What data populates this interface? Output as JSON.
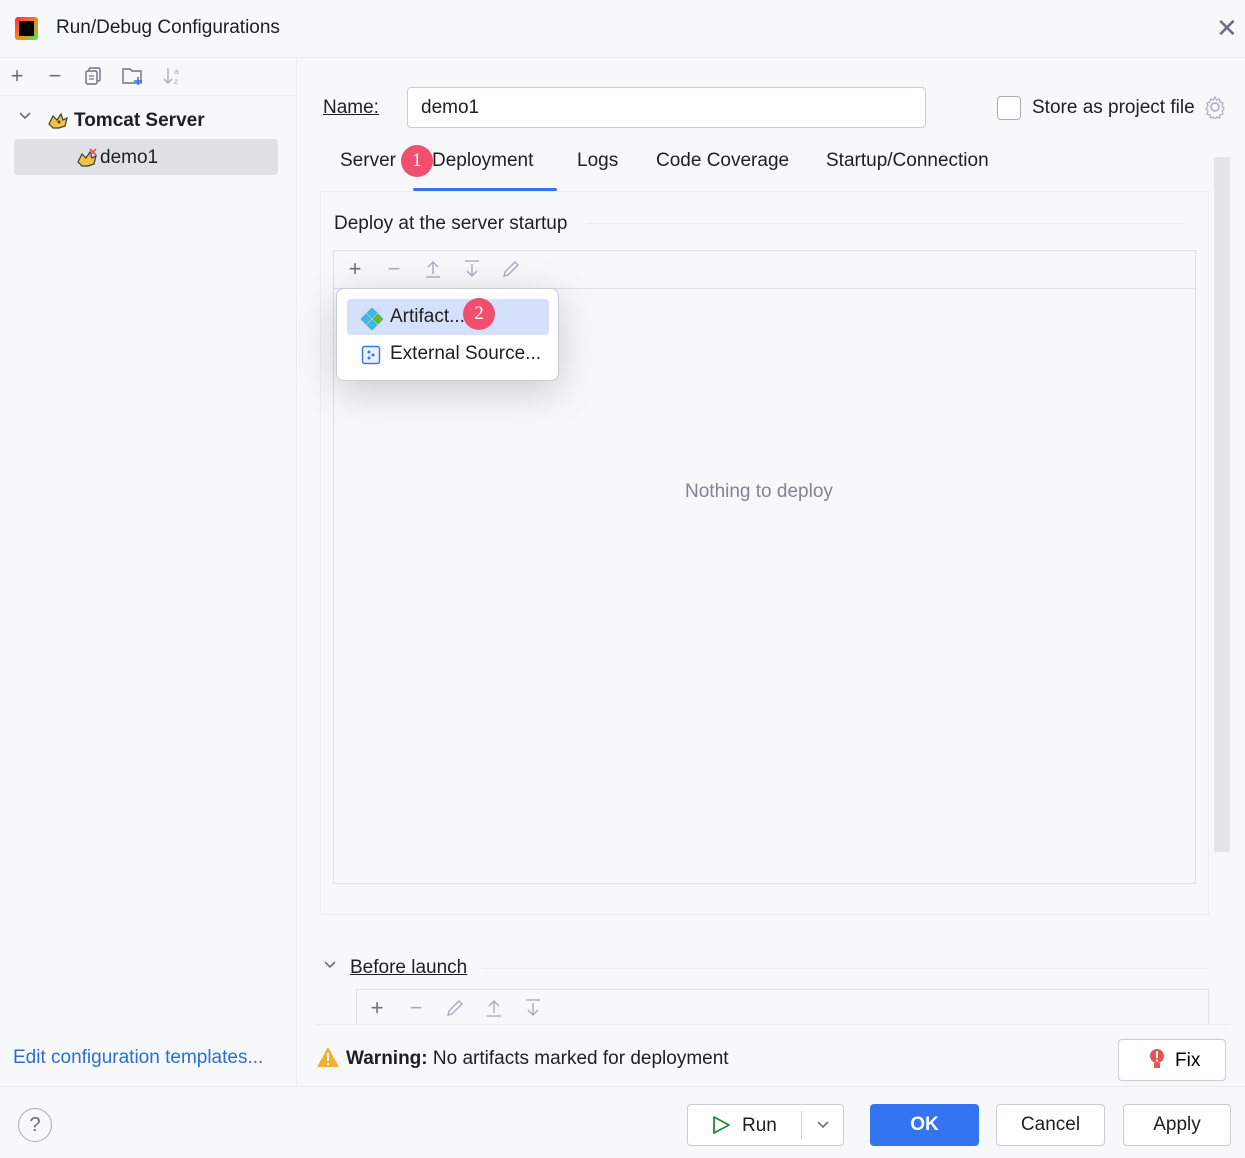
{
  "window": {
    "title": "Run/Debug Configurations"
  },
  "left_toolbar": {
    "icons": [
      "add-icon",
      "remove-icon",
      "copy-icon",
      "new-folder-icon",
      "sort-icon"
    ]
  },
  "tree": {
    "group_label": "Tomcat Server",
    "item_label": "demo1"
  },
  "edit_templates_link": "Edit configuration templates...",
  "name": {
    "label": "Name:",
    "value": "demo1"
  },
  "store_as_project_file": {
    "label": "Store as project file",
    "checked": false
  },
  "tabs": [
    {
      "label": "Server"
    },
    {
      "label": "Deployment",
      "active": true
    },
    {
      "label": "Logs"
    },
    {
      "label": "Code Coverage"
    },
    {
      "label": "Startup/Connection"
    }
  ],
  "badges": {
    "first": "1",
    "second": "2"
  },
  "deploy_section": {
    "title": "Deploy at the server startup",
    "empty_text": "Nothing to deploy"
  },
  "popup_menu": {
    "items": [
      {
        "label": "Artifact..."
      },
      {
        "label": "External Source..."
      }
    ]
  },
  "before_launch": {
    "label": "Before launch"
  },
  "warning": {
    "bold": "Warning:",
    "text": " No artifacts marked for deployment"
  },
  "buttons": {
    "fix": "Fix",
    "run": "Run",
    "ok": "OK",
    "cancel": "Cancel",
    "apply": "Apply"
  },
  "help": {
    "glyph": "?"
  },
  "colors": {
    "accent": "#3574f0",
    "badge": "#f0506e",
    "selection": "#d5e1fb",
    "link": "#2f6cd3"
  }
}
